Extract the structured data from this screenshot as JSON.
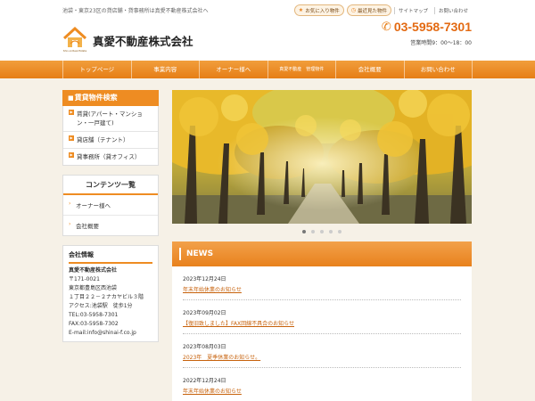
{
  "header": {
    "tagline": "池袋・東京23区の貸店舗・貸事務所は真愛不動産株式会社へ",
    "favorites_label": "お気に入り物件",
    "recent_label": "最近見た物件",
    "sitemap_label": "サイトマップ",
    "contact_label": "お問い合わせ",
    "brand": "真愛不動産株式会社",
    "logo_sub": "Shin-Ai Real Estate",
    "phone": "03-5958-7301",
    "hours": "営業時間9：00～18：00"
  },
  "nav": {
    "items": [
      {
        "label": "トップページ"
      },
      {
        "label": "事業内容"
      },
      {
        "label": "オーナー様へ"
      },
      {
        "label": "真愛不動産　管理物件"
      },
      {
        "label": "会社概要"
      },
      {
        "label": "お問い合わせ"
      }
    ]
  },
  "sidebar": {
    "search_title": "賃貸物件検索",
    "search_items": [
      {
        "label": "賃貸(アパート・マンション・一戸建て)"
      },
      {
        "label": "貸店舗（テナント）"
      },
      {
        "label": "貸事務所（貸オフィス）"
      }
    ],
    "contents_title": "コンテンツ一覧",
    "contents_items": [
      {
        "label": "オーナー様へ"
      },
      {
        "label": "会社概要"
      }
    ],
    "company": {
      "title": "会社情報",
      "name": "真愛不動産株式会社",
      "postal": "〒171-0021",
      "address1": "東京都豊島区西池袋",
      "address2": "１丁目２２－２ナカヤビル３階",
      "access": "アクセス:池袋駅　徒歩1分",
      "tel": "TEL:03-5958-7301",
      "fax": "FAX:03-5958-7302",
      "email": "E-mail:info@shinai-f.co.jp"
    }
  },
  "slider": {
    "dot_count": 5,
    "active_index": 0
  },
  "news": {
    "title": "NEWS",
    "items": [
      {
        "date": "2023年12月24日",
        "title": "年末年始休業のお知らせ"
      },
      {
        "date": "2023年09月02日",
        "title": "【復旧致しました】FAX回線不具合のお知らせ"
      },
      {
        "date": "2023年08月03日",
        "title": "2023年　夏季休業のお知らせ。"
      },
      {
        "date": "2022年12月24日",
        "title": "年末年始休業のお知らせ"
      }
    ]
  },
  "colors": {
    "accent": "#ee8c22",
    "link": "#c7620c"
  }
}
